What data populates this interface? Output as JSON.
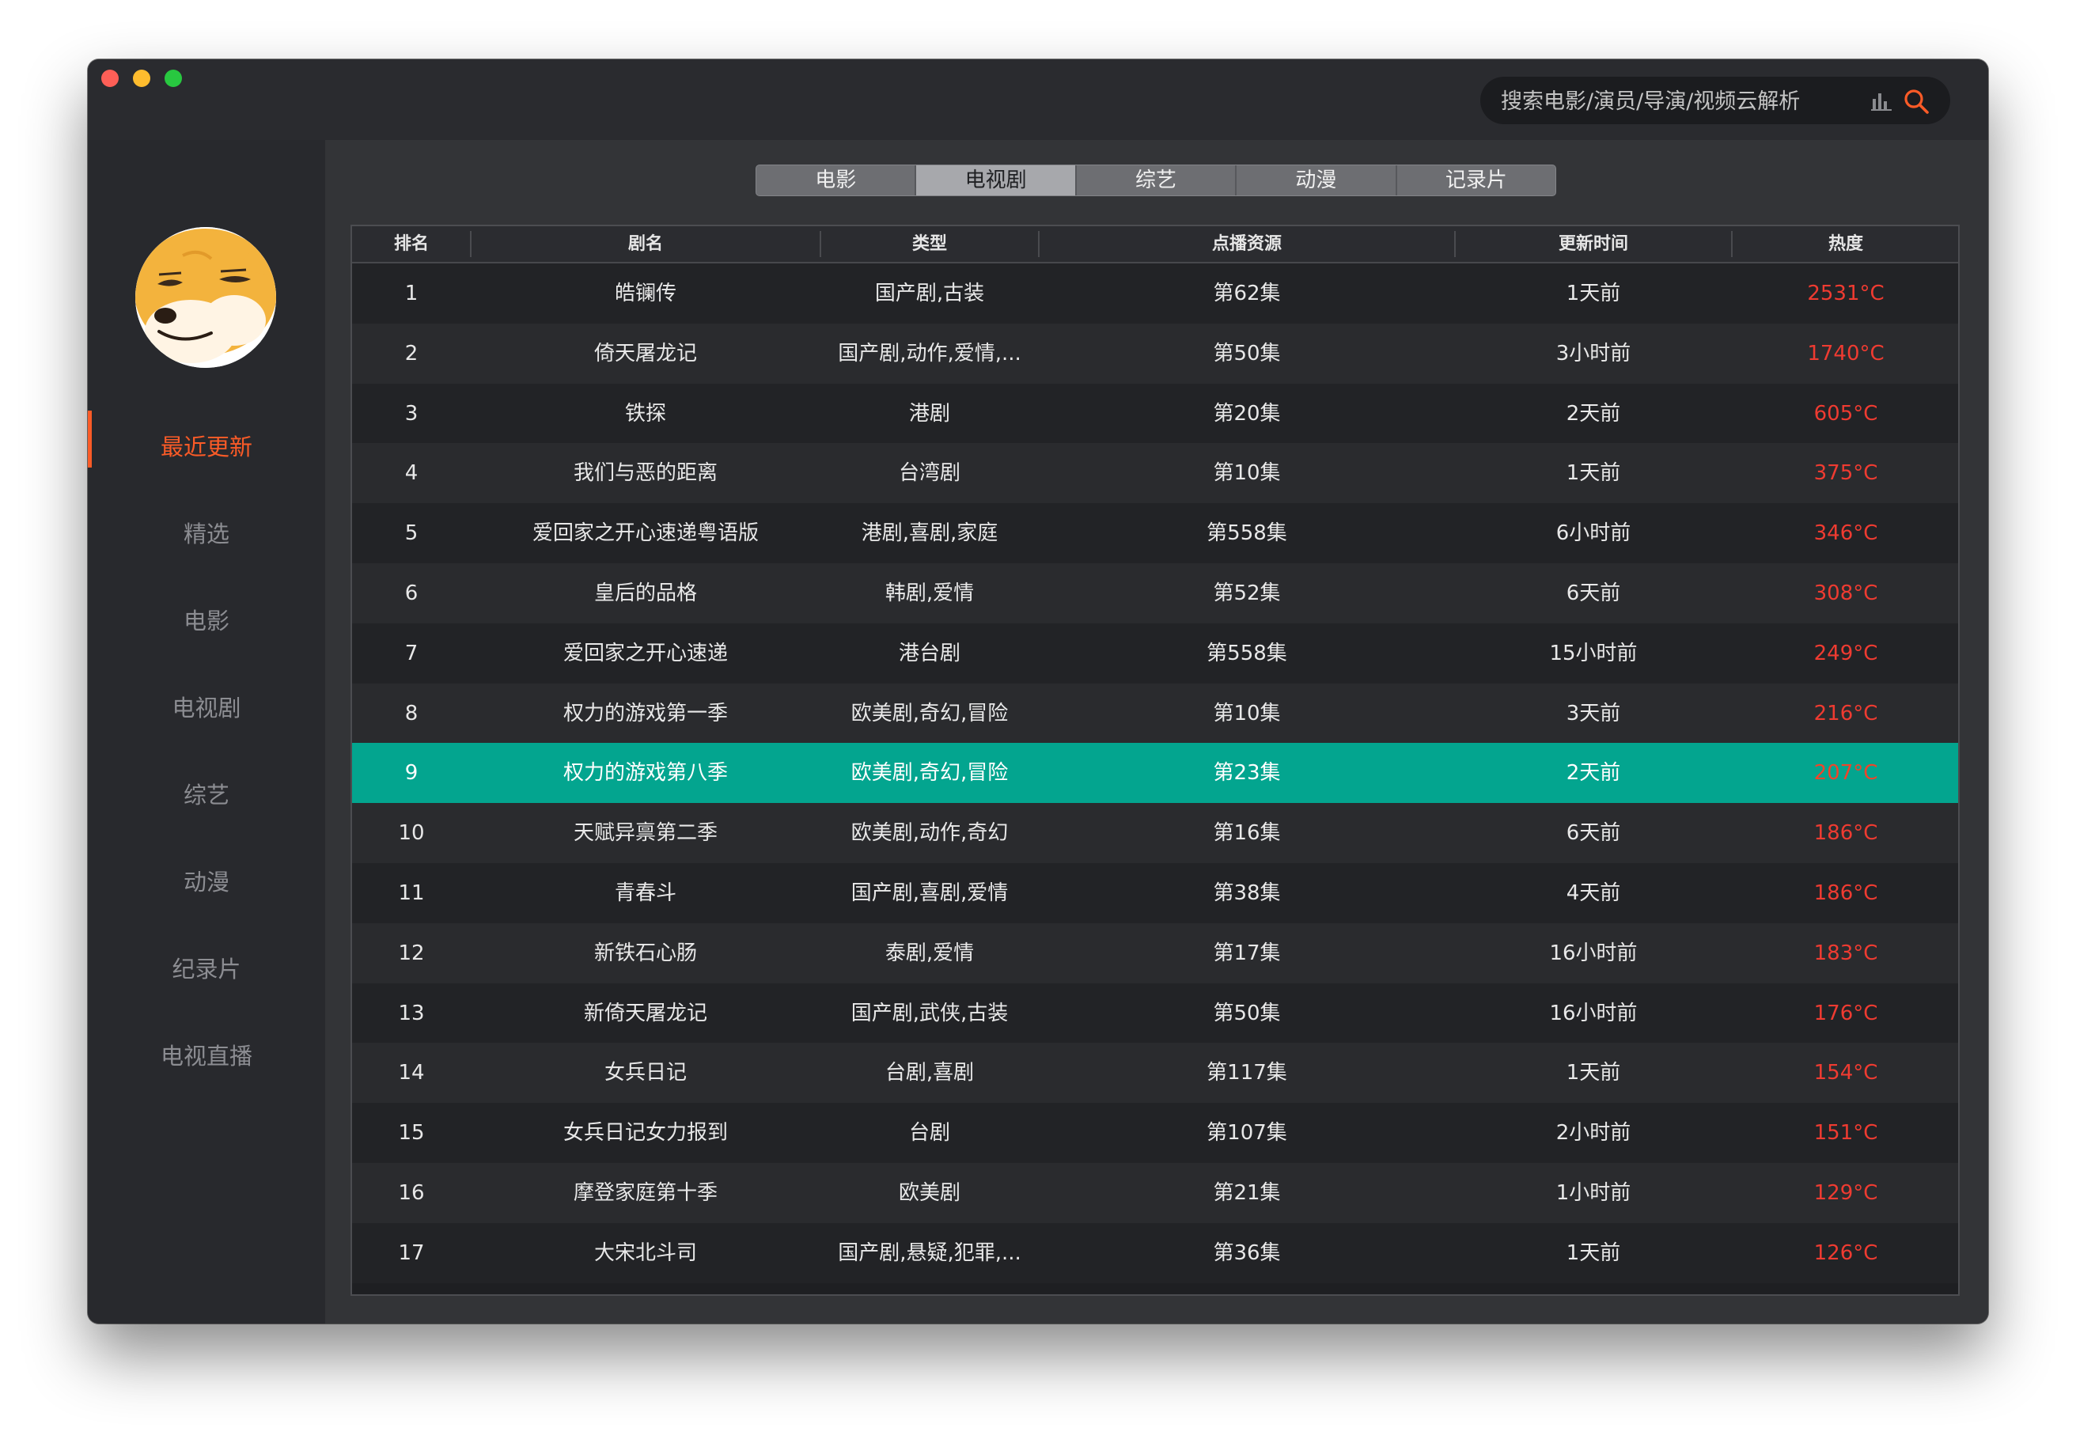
{
  "search": {
    "placeholder": "搜索电影/演员/导演/视频云解析"
  },
  "sidebar": {
    "items": [
      {
        "label": "最近更新",
        "active": true
      },
      {
        "label": "精选"
      },
      {
        "label": "电影"
      },
      {
        "label": "电视剧"
      },
      {
        "label": "综艺"
      },
      {
        "label": "动漫"
      },
      {
        "label": "纪录片"
      },
      {
        "label": "电视直播"
      }
    ]
  },
  "tabs": [
    {
      "label": "电影"
    },
    {
      "label": "电视剧",
      "active": true
    },
    {
      "label": "综艺"
    },
    {
      "label": "动漫"
    },
    {
      "label": "记录片"
    }
  ],
  "table": {
    "headers": [
      "排名",
      "剧名",
      "类型",
      "点播资源",
      "更新时间",
      "热度"
    ],
    "selected_row": 9,
    "rows": [
      [
        "1",
        "皓镧传",
        "国产剧,古装",
        "第62集",
        "1天前",
        "2531°C"
      ],
      [
        "2",
        "倚天屠龙记",
        "国产剧,动作,爱情,...",
        "第50集",
        "3小时前",
        "1740°C"
      ],
      [
        "3",
        "铁探",
        "港剧",
        "第20集",
        "2天前",
        "605°C"
      ],
      [
        "4",
        "我们与恶的距离",
        "台湾剧",
        "第10集",
        "1天前",
        "375°C"
      ],
      [
        "5",
        "爱回家之开心速递粤语版",
        "港剧,喜剧,家庭",
        "第558集",
        "6小时前",
        "346°C"
      ],
      [
        "6",
        "皇后的品格",
        "韩剧,爱情",
        "第52集",
        "6天前",
        "308°C"
      ],
      [
        "7",
        "爱回家之开心速递",
        "港台剧",
        "第558集",
        "15小时前",
        "249°C"
      ],
      [
        "8",
        "权力的游戏第一季",
        "欧美剧,奇幻,冒险",
        "第10集",
        "3天前",
        "216°C"
      ],
      [
        "9",
        "权力的游戏第八季",
        "欧美剧,奇幻,冒险",
        "第23集",
        "2天前",
        "207°C"
      ],
      [
        "10",
        "天赋异禀第二季",
        "欧美剧,动作,奇幻",
        "第16集",
        "6天前",
        "186°C"
      ],
      [
        "11",
        "青春斗",
        "国产剧,喜剧,爱情",
        "第38集",
        "4天前",
        "186°C"
      ],
      [
        "12",
        "新铁石心肠",
        "泰剧,爱情",
        "第17集",
        "16小时前",
        "183°C"
      ],
      [
        "13",
        "新倚天屠龙记",
        "国产剧,武侠,古装",
        "第50集",
        "16小时前",
        "176°C"
      ],
      [
        "14",
        "女兵日记",
        "台剧,喜剧",
        "第117集",
        "1天前",
        "154°C"
      ],
      [
        "15",
        "女兵日记女力报到",
        "台剧",
        "第107集",
        "2小时前",
        "151°C"
      ],
      [
        "16",
        "摩登家庭第十季",
        "欧美剧",
        "第21集",
        "1小时前",
        "129°C"
      ],
      [
        "17",
        "大宋北斗司",
        "国产剧,悬疑,犯罪,...",
        "第36集",
        "1天前",
        "126°C"
      ]
    ]
  }
}
